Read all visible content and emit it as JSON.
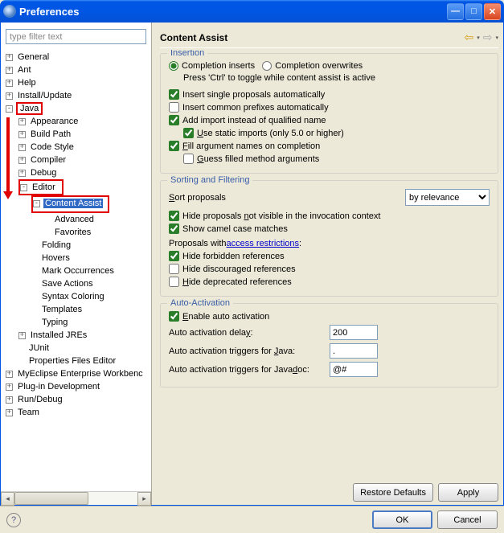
{
  "window": {
    "title": "Preferences"
  },
  "filter": {
    "placeholder": "type filter text"
  },
  "tree": {
    "general": "General",
    "ant": "Ant",
    "help": "Help",
    "install": "Install/Update",
    "java": "Java",
    "appearance": "Appearance",
    "buildpath": "Build Path",
    "codestyle": "Code Style",
    "compiler": "Compiler",
    "debug": "Debug",
    "editor": "Editor",
    "contentassist": "Content Assist",
    "advanced": "Advanced",
    "favorites": "Favorites",
    "folding": "Folding",
    "hovers": "Hovers",
    "markocc": "Mark Occurrences",
    "saveactions": "Save Actions",
    "syntax": "Syntax Coloring",
    "templates": "Templates",
    "typing": "Typing",
    "installedjres": "Installed JREs",
    "junit": "JUnit",
    "propfiles": "Properties Files Editor",
    "myeclipse": "MyEclipse Enterprise Workbenc",
    "plugin": "Plug-in Development",
    "rundebug": "Run/Debug",
    "team": "Team"
  },
  "page": {
    "title": "Content Assist",
    "insertion": {
      "legend": "Insertion",
      "radio_inserts": "Completion inserts",
      "radio_overwrites": "Completion overwrites",
      "hint": "Press 'Ctrl' to toggle while content assist is active",
      "cb_single": "Insert single proposals automatically",
      "cb_prefix": "Insert common prefixes automatically",
      "cb_addimport": "Add import instead of qualified name",
      "cb_static": "Use static imports (only 5.0 or higher)",
      "cb_fillarg": "Fill argument names on completion",
      "cb_guess": "Guess filled method arguments"
    },
    "sorting": {
      "legend": "Sorting and Filtering",
      "sort_label": "Sort proposals",
      "sort_value": "by relevance",
      "cb_hideinvoc": "Hide proposals not visible in the invocation context",
      "cb_camel": "Show camel case matches",
      "proposals_prefix": "Proposals with ",
      "proposals_link": "access restrictions",
      "proposals_suffix": ":",
      "cb_hideforbidden": "Hide forbidden references",
      "cb_hidediscouraged": "Hide discouraged references",
      "cb_hidedeprec": "Hide deprecated references"
    },
    "autoact": {
      "legend": "Auto-Activation",
      "cb_enable": "Enable auto activation",
      "delay_label": "Auto activation delay:",
      "delay_value": "200",
      "java_label": "Auto activation triggers for Java:",
      "java_value": ".",
      "jdoc_label": "Auto activation triggers for Javadoc:",
      "jdoc_value": "@#"
    }
  },
  "buttons": {
    "restore": "Restore Defaults",
    "apply": "Apply",
    "ok": "OK",
    "cancel": "Cancel"
  }
}
